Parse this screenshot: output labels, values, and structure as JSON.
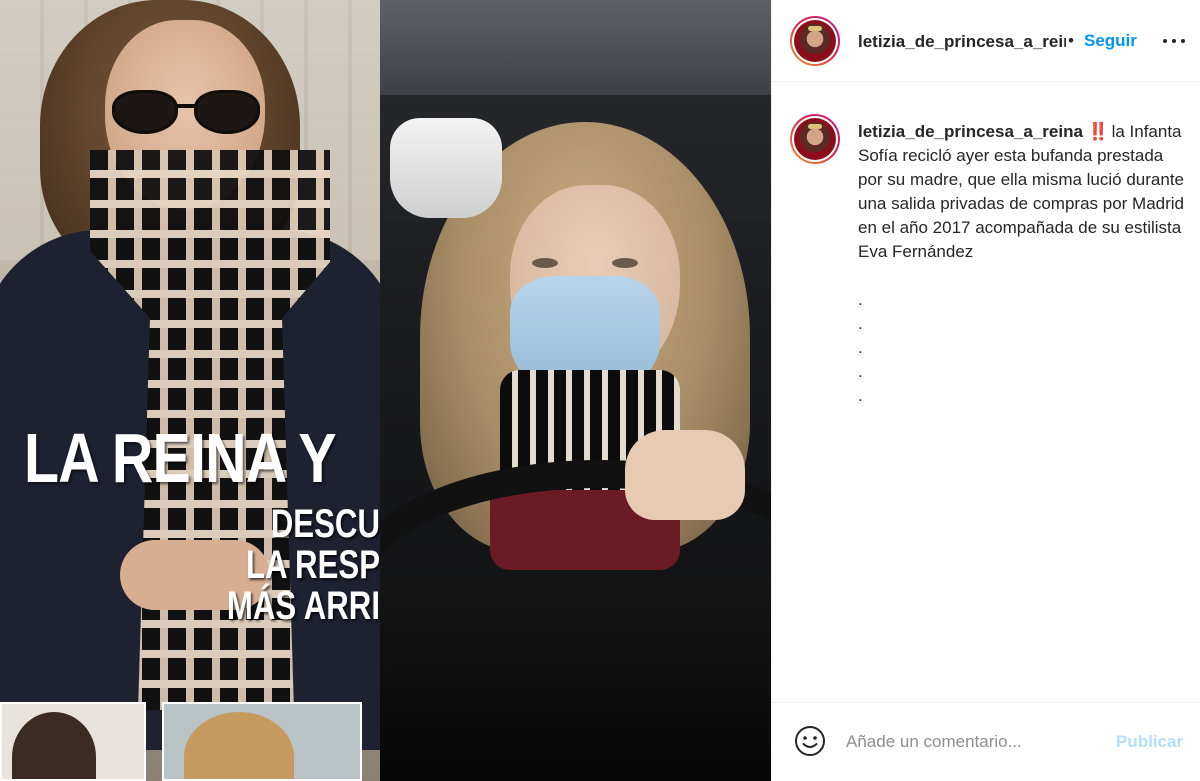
{
  "photo": {
    "left_magazine": {
      "headline": "LA REINA Y",
      "sub_lines": [
        "DESCU",
        "LA RESP",
        "MÁS ARRI"
      ]
    }
  },
  "header": {
    "username": "letizia_de_princesa_a_reina",
    "separator": "•",
    "follow_label": "Seguir",
    "more_icon": "more-horizontal-icon"
  },
  "caption": {
    "username": "letizia_de_princesa_a_reina",
    "emoji": "‼️",
    "text": "la Infanta Sofía recicló ayer esta bufanda prestada por su madre, que ella misma lució durante una salida privadas de compras por Madrid en el año 2017 acompañada de su estilista Eva Fernández",
    "dots": [
      ".",
      ".",
      ".",
      ".",
      "."
    ]
  },
  "footer": {
    "emoji_icon": "smiley-icon",
    "comment_placeholder": "Añade un comentario...",
    "publish_label": "Publicar"
  },
  "colors": {
    "link_blue": "#0095f6",
    "publish_disabled": "#b2dffc",
    "text": "#262626",
    "muted": "#8e8e8e"
  }
}
